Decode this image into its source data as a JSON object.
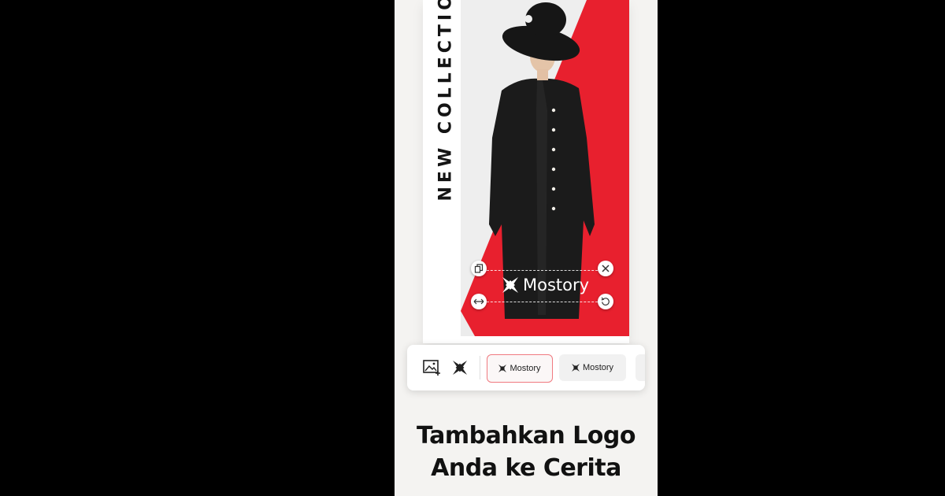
{
  "story": {
    "vertical_title": "NEW COLLECTION",
    "accent_color": "#e8202e",
    "coat_color": "#1b1b1b"
  },
  "logo_overlay": {
    "text": "Mostory",
    "handles": [
      "copy-icon",
      "close-icon",
      "resize-horizontal-icon",
      "rotate-icon"
    ]
  },
  "toolbar": {
    "add_image_icon": "image-plus-icon",
    "logo_icon": "mostory-logo-icon",
    "options": [
      {
        "label": "Mostory",
        "selected": true
      },
      {
        "label": "Mostory",
        "selected": false
      }
    ]
  },
  "caption": {
    "line1": "Tambahkan Logo",
    "line2": "Anda ke Cerita"
  }
}
